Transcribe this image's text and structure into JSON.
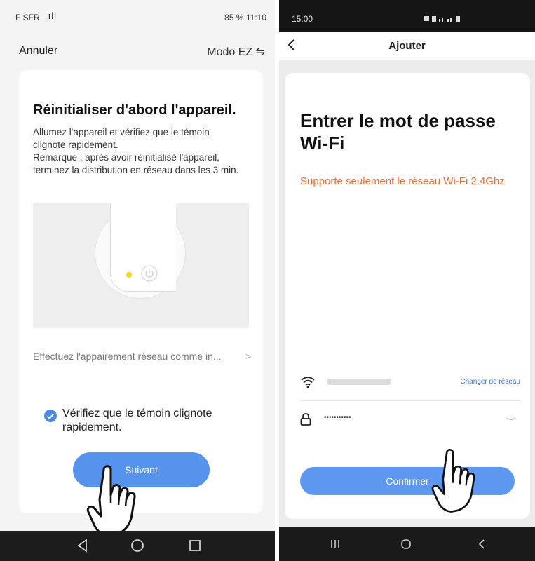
{
  "left": {
    "status": {
      "carrier": "F SFR",
      "signal": ".ıll",
      "right": "85 % 11:10"
    },
    "top": {
      "cancel": "Annuler",
      "mode": "Modo EZ ⇋"
    },
    "title": "Réinitialiser d'abord l'appareil.",
    "description": "Allumez l'appareil et vérifiez que le témoin clignote rapidement.\nRemarque : après avoir réinitialisé l'appareil, terminez la distribution en réseau dans les 3 min.",
    "link": "Effectuez l'appairement réseau comme in...",
    "link_chevron": ">",
    "check_text": "Vérifiez que le témoin clignote rapidement.",
    "next_button": "Suivant",
    "led_color": "#f1d21c",
    "accent": "#5593ec"
  },
  "right": {
    "status": {
      "time": "15:00"
    },
    "top": {
      "title": "Ajouter"
    },
    "title": "Entrer le mot de passe Wi-Fi",
    "warning": "Supporte seulement le réseau Wi-Fi 2.4Ghz",
    "change_network": "Changer de réseau",
    "password_mask": "•••••••••••",
    "confirm_button": "Confirmer",
    "warning_color": "#f26b2c",
    "accent": "#5d97ef"
  }
}
